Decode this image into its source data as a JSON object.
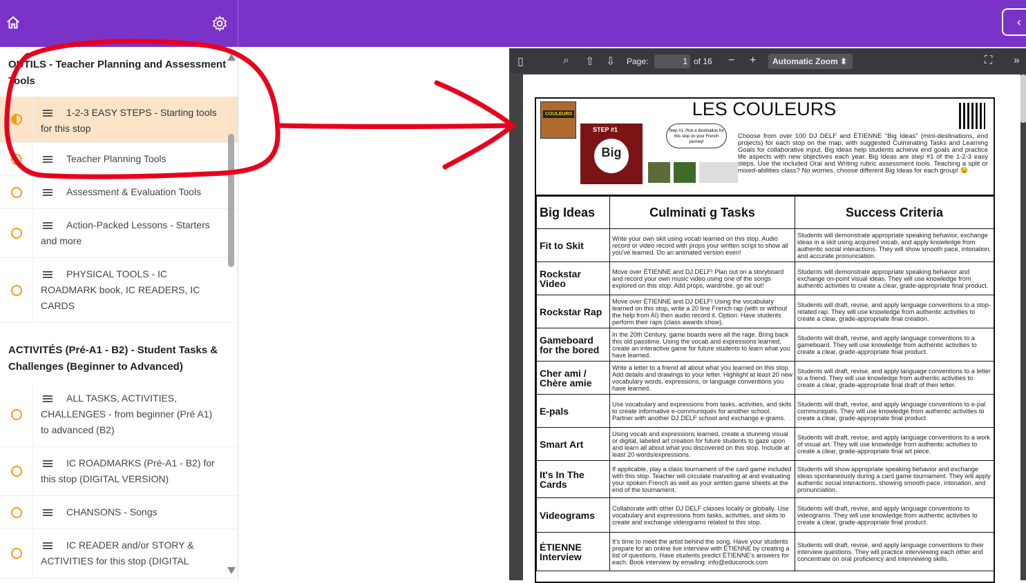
{
  "sidebar": {
    "sections": [
      {
        "title": "OUTILS - Teacher Planning and Assessment Tools",
        "lessons": [
          {
            "label": "1-2-3 EASY STEPS - Starting tools for this stop",
            "active": true
          },
          {
            "label": "Teacher Planning Tools"
          },
          {
            "label": "Assessment & Evaluation Tools"
          },
          {
            "label": "Action-Packed Lessons - Starters and more"
          },
          {
            "label": "PHYSICAL TOOLS - IC ROADMARK book, IC READERS, IC CARDS"
          }
        ]
      },
      {
        "title": "ACTIVITÉS (Pré-A1 - B2) - Student Tasks & Challenges (Beginner to Advanced)",
        "lessons": [
          {
            "label": "ALL TASKS, ACTIVITIES, CHALLENGES - from beginner (Pré A1) to advanced (B2)"
          },
          {
            "label": "IC ROADMARKS (Pré-A1 - B2) for this stop (DIGITAL VERSION)"
          },
          {
            "label": "CHANSONS - Songs"
          },
          {
            "label": "IC READER and/or STORY & ACTIVITIES for this stop (DIGITAL"
          }
        ]
      }
    ]
  },
  "viewer": {
    "page_label": "Page:",
    "page_current": "1",
    "page_total": "of 16",
    "zoom": "Automatic Zoom"
  },
  "document": {
    "logo_text": "COULEURS",
    "step_label": "STEP #1",
    "big_ideas_badge": "Big",
    "bubble_text": "Step #1. Pick a destination for this stop on your French journey!",
    "title": "LES COULEURS",
    "intro": "Choose from over 100 DJ DELF and ÉTIENNE \"Big Ideas\" (mini-destinations, end projects) for each stop on the map, with suggested Culminating Tasks and Learning Goals for collaborative input. Big ideas help students achieve end goals and practice life aspects with new objectives each year. Big Ideas are step #1 of the 1-2-3 easy steps. Use the included Oral and Writing rubric assessment tools. Teaching a split or mixed-abilities class? No worries, choose different Big Ideas for each group! 😉",
    "headers": [
      "Big Ideas",
      "Culminati g Tasks",
      "Success Criteria"
    ],
    "rows": [
      {
        "idea": "Fit to Skit",
        "task": "Write your own skit using vocab learned on this stop. Audio record or video record with props your written script to show all you've learned. Do an animated version even!",
        "criteria": "Students will demonstrate appropriate speaking behavior, exchange ideas in a skit using acquired vocab, and apply knowledge from authentic social interactions. They will show smooth pace, intonation, and accurate pronunciation."
      },
      {
        "idea": "Rockstar Video",
        "task": "Move over ÉTIENNE and DJ DELF! Plan out on a storyboard and record your own music video using one of the songs explored on this stop. Add props, wardrobe, go all out!",
        "criteria": "Students will demonstrate appropriate speaking behavior and exchange on-point visual ideas. They will use knowledge from authentic activities to create a clear, grade-appropriate final product."
      },
      {
        "idea": "Rockstar Rap",
        "task": "Move over ÉTIENNE and DJ DELF! Using the vocabulary learned on this stop, write a 20 line French rap (with or without the help from AI) then audio record it. Option: Have students perform their raps (class awards show).",
        "criteria": "Students will draft, revise, and apply language conventions to a stop-related rap. They will use knowledge from authentic activities to create a clear, grade-appropriate final creation."
      },
      {
        "idea": "Gameboard for the bored",
        "task": "In the 20th Century, game boards were all the rage. Bring back this old passtime. Using the vocab and expressions learned, create an interactive game for future students to learn what you have learned.",
        "criteria": "Students will draft, revise, and apply language conventions to a gameboard. They will use knowledge from authentic activities to create a clear, grade-appropriate final product."
      },
      {
        "idea": "Cher ami / Chère amie",
        "task": "Write a letter to a friend all about what you learned on this stop. Add details and drawings to your letter. Highlight at least 20 new vocabulary words, expressions, or language conventions you have learned.",
        "criteria": "Students will draft, revise, and apply language conventions to a letter to a friend. They will use knowledge from authentic activities to create a clear, grade-appropriate final draft of their letter."
      },
      {
        "idea": "E-pals",
        "task": "Use vocabulary and expressions from tasks, activities, and skits to create informative e-communiqués for another school. Partner with another DJ DELF school and exchange e-grams.",
        "criteria": "Students will draft, revise, and apply language conventions to e-pal communiqués. They will use knowledge from authentic activities to create a clear, grade-appropriate final product."
      },
      {
        "idea": "Smart Art",
        "task": "Using vocab and expressions learned, create a stunning visual or digital, labeled art creation for future students to gaze upon and learn all about what you discovered on this stop. Include at least 20 words/expressions.",
        "criteria": "Students will draft, revise, and apply language conventions to a work of visual art. They will use knowledge from authentic activities to create a clear, grade-appropriate final art piece."
      },
      {
        "idea": "It's In The Cards",
        "task": "If applicable, play a class tournament of the card game included with this stop. Teacher will circulate marveling at and evaluating your spoken French as well as your written game sheets at the end of the tournament.",
        "criteria": "Students will show appropriate speaking behavior and exchange ideas spontaneously during a card game tournament. They will apply authentic social interactions, showing smooth pace, intonation, and pronunciation."
      },
      {
        "idea": "Videograms",
        "task": "Collaborate with other DJ DELF classes locally or globally. Use vocabulary and expressions from tasks, activities, and skits to create and exchange videograms related to this stop.",
        "criteria": "Students will draft, revise, and apply language conventions to videograms. They will use knowledge from authentic activities to create a clear, grade-appropriate final product."
      },
      {
        "idea": "ÉTIENNE Interview",
        "task": "It's time to meet the artist behind the song. Have your students prepare for an online live interview with ÉTIENNE by creating a list of questions. Have students predict ÉTIENNE's answers for each. Book interview by emailing: info@educorock.com",
        "criteria": "Students will draft, revise, and apply language conventions to their interview questions. They will practice interviewing each other and concentrate on oral proficiency and interviewing skills."
      }
    ]
  },
  "colors": {
    "brand": "#7a33c8",
    "active_lesson": "#fce4c8",
    "status_ring": "#f39c12",
    "annotation": "#e8001c"
  },
  "icons": [
    "home-icon",
    "gear-icon",
    "sidebar-toggle-icon",
    "search-icon",
    "arrow-up-icon",
    "arrow-down-icon",
    "minus-icon",
    "plus-icon",
    "fullscreen-icon",
    "chevrons-right-icon",
    "document-lines-icon"
  ]
}
